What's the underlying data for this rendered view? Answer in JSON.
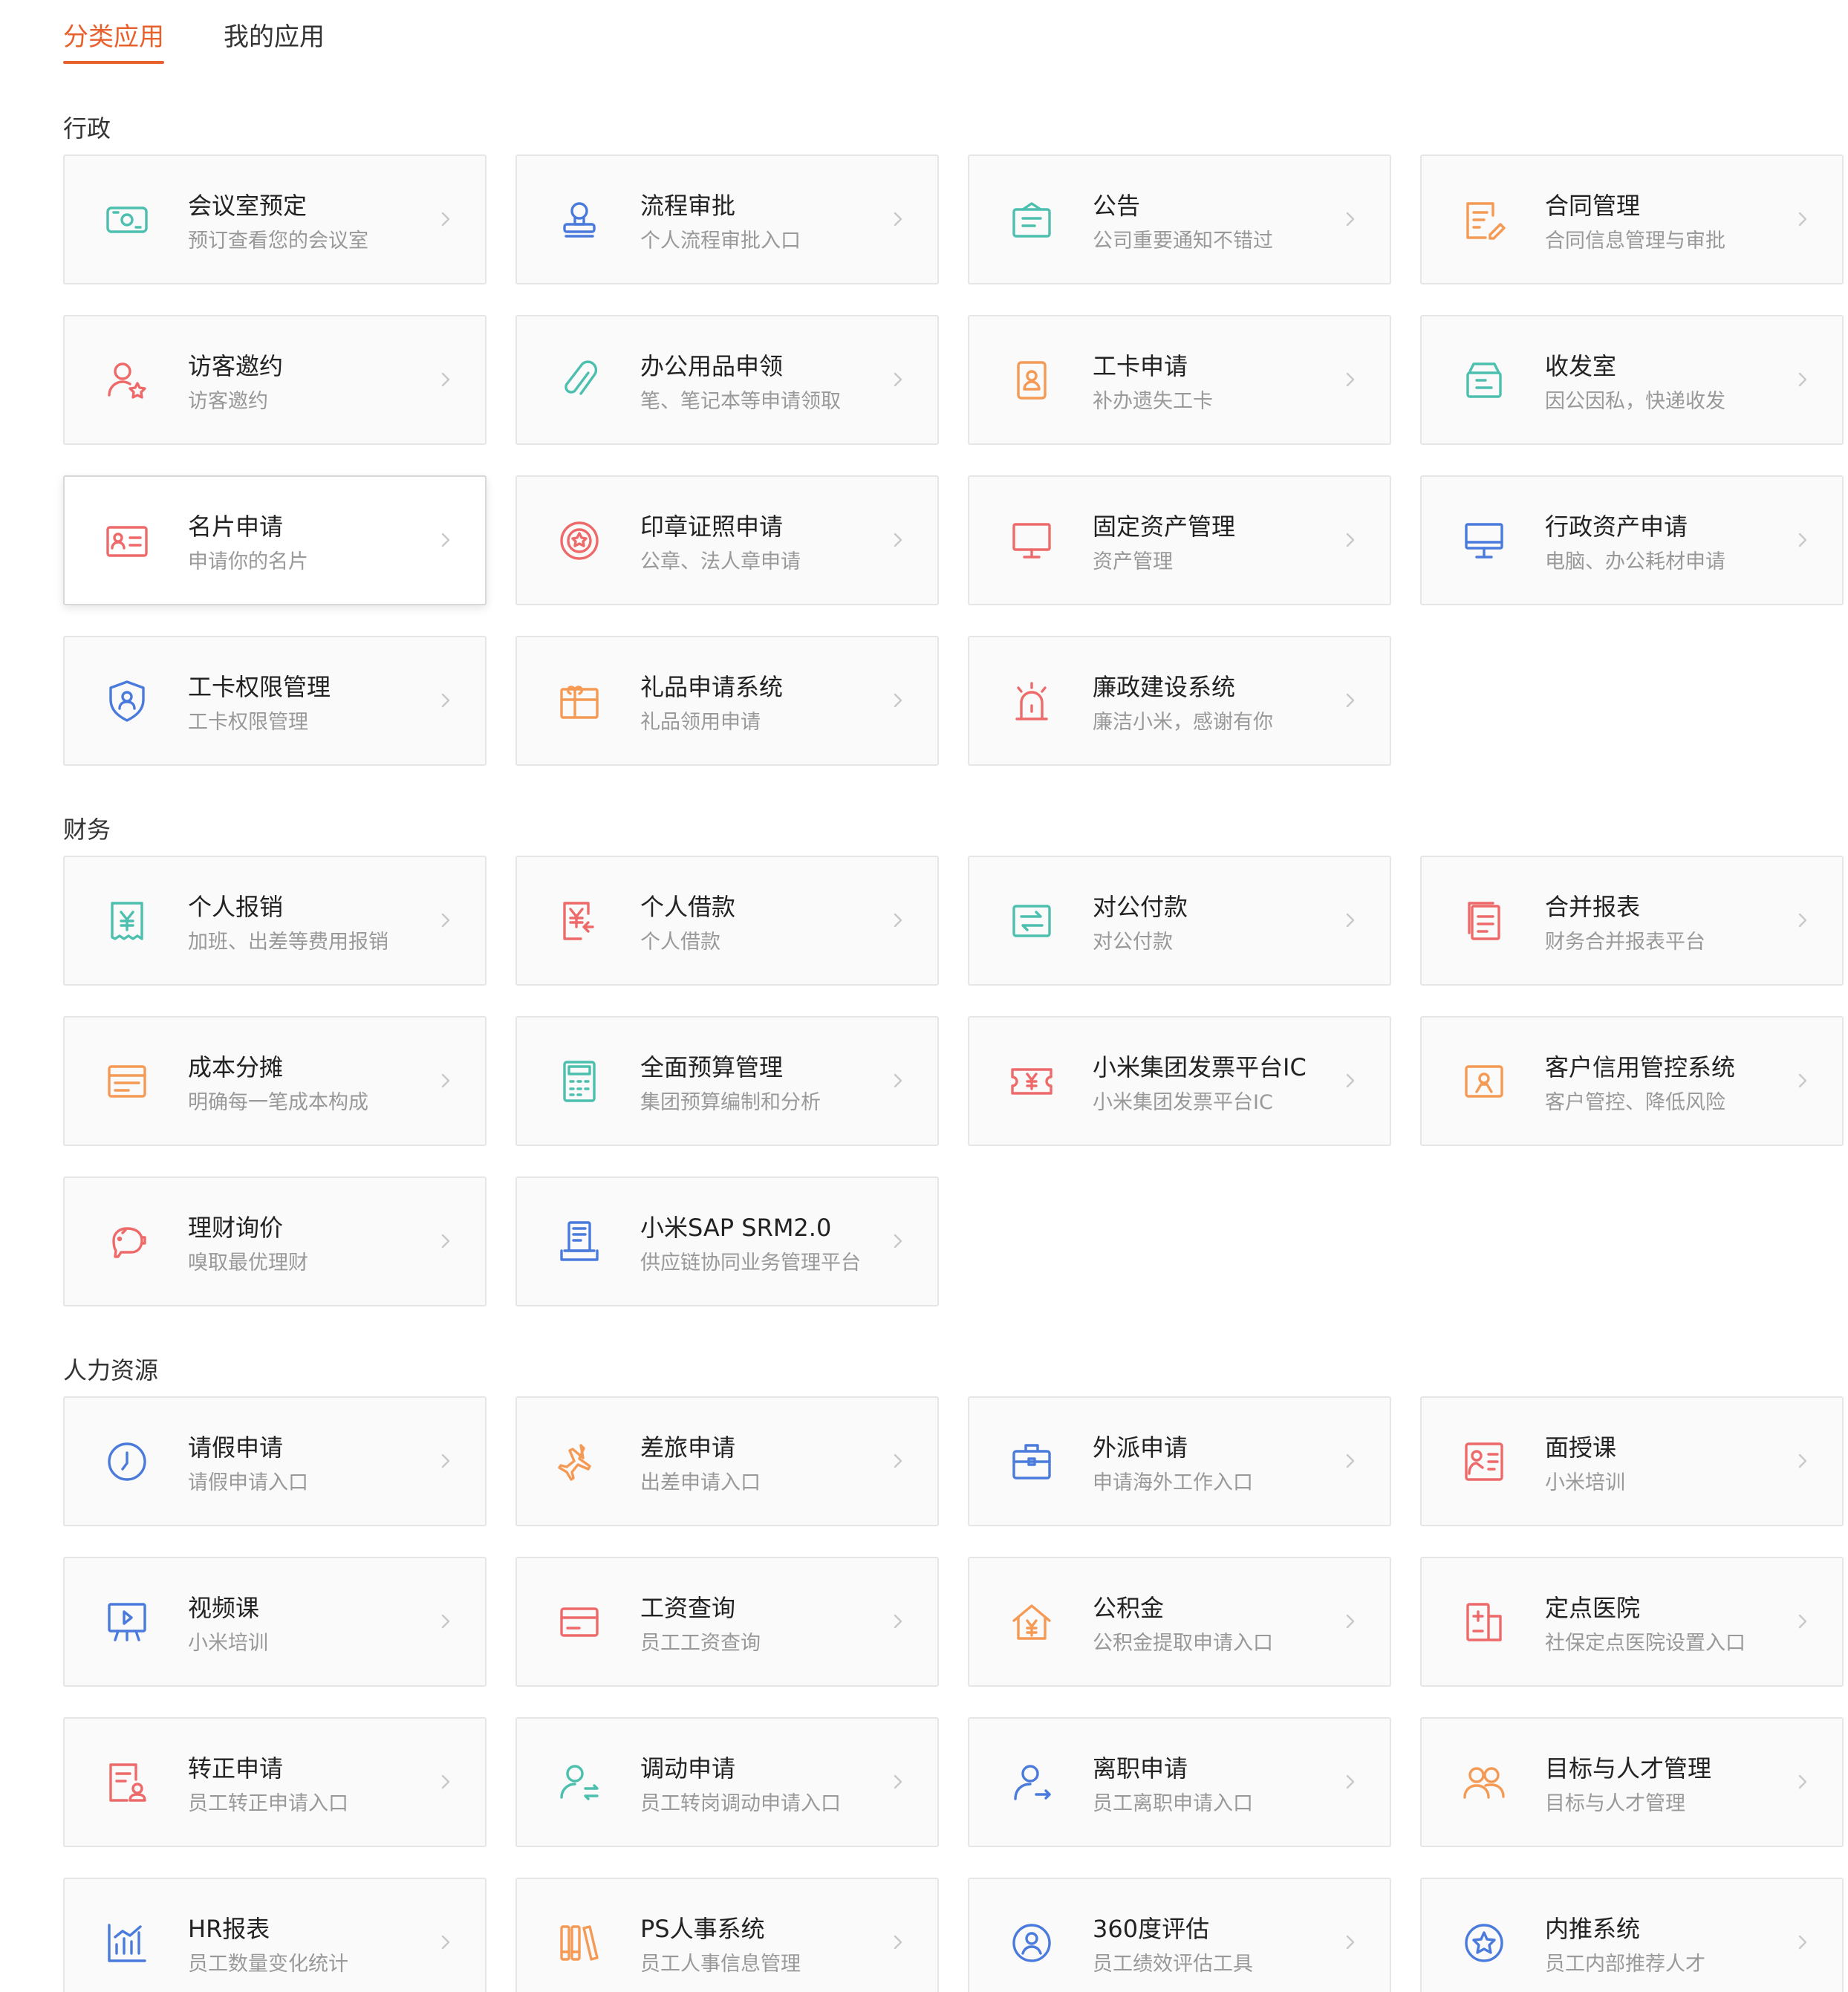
{
  "tabs": [
    {
      "label": "分类应用",
      "active": true
    },
    {
      "label": "我的应用",
      "active": false
    }
  ],
  "colors": {
    "accent": "#e8612c",
    "teal": "#4cbfae",
    "blue": "#4a7bdc",
    "orange": "#f59a54",
    "red": "#ee6a6a"
  },
  "sections": [
    {
      "title": "行政",
      "items": [
        {
          "title": "会议室预定",
          "subtitle": "预订查看您的会议室",
          "icon": "money-icon",
          "color": "#4cbfae"
        },
        {
          "title": "流程审批",
          "subtitle": "个人流程审批入口",
          "icon": "stamp-icon",
          "color": "#4a7bdc"
        },
        {
          "title": "公告",
          "subtitle": "公司重要通知不错过",
          "icon": "notice-icon",
          "color": "#4cbfae"
        },
        {
          "title": "合同管理",
          "subtitle": "合同信息管理与审批",
          "icon": "contract-edit-icon",
          "color": "#f59a54"
        },
        {
          "title": "访客邀约",
          "subtitle": "访客邀约",
          "icon": "visitor-star-icon",
          "color": "#ee6a6a"
        },
        {
          "title": "办公用品申领",
          "subtitle": "笔、笔记本等申请领取",
          "icon": "paperclip-icon",
          "color": "#4cbfae"
        },
        {
          "title": "工卡申请",
          "subtitle": "补办遗失工卡",
          "icon": "badge-icon",
          "color": "#f59a54"
        },
        {
          "title": "收发室",
          "subtitle": "因公因私，快递收发",
          "icon": "package-icon",
          "color": "#4cbfae"
        },
        {
          "title": "名片申请",
          "subtitle": "申请你的名片",
          "icon": "business-card-icon",
          "color": "#ee6a6a"
        },
        {
          "title": "印章证照申请",
          "subtitle": "公章、法人章申请",
          "icon": "seal-icon",
          "color": "#ee6a6a"
        },
        {
          "title": "固定资产管理",
          "subtitle": "资产管理",
          "icon": "monitor-icon",
          "color": "#ee6a6a"
        },
        {
          "title": "行政资产申请",
          "subtitle": "电脑、办公耗材申请",
          "icon": "computer-icon",
          "color": "#4a7bdc"
        },
        {
          "title": "工卡权限管理",
          "subtitle": "工卡权限管理",
          "icon": "shield-user-icon",
          "color": "#4a7bdc"
        },
        {
          "title": "礼品申请系统",
          "subtitle": "礼品领用申请",
          "icon": "gift-icon",
          "color": "#f59a54"
        },
        {
          "title": "廉政建设系统",
          "subtitle": "廉洁小米，感谢有你",
          "icon": "alarm-icon",
          "color": "#ee6a6a"
        }
      ]
    },
    {
      "title": "财务",
      "items": [
        {
          "title": "个人报销",
          "subtitle": "加班、出差等费用报销",
          "icon": "receipt-yen-icon",
          "color": "#4cbfae"
        },
        {
          "title": "个人借款",
          "subtitle": "个人借款",
          "icon": "loan-yen-icon",
          "color": "#ee6a6a"
        },
        {
          "title": "对公付款",
          "subtitle": "对公付款",
          "icon": "transfer-icon",
          "color": "#4cbfae"
        },
        {
          "title": "合并报表",
          "subtitle": "财务合并报表平台",
          "icon": "report-merge-icon",
          "color": "#ee6a6a"
        },
        {
          "title": "成本分摊",
          "subtitle": "明确每一笔成本构成",
          "icon": "cost-card-icon",
          "color": "#f59a54"
        },
        {
          "title": "全面预算管理",
          "subtitle": "集团预算编制和分析",
          "icon": "calculator-icon",
          "color": "#4cbfae"
        },
        {
          "title": "小米集团发票平台IC",
          "subtitle": "小米集团发票平台IC",
          "icon": "invoice-ticket-icon",
          "color": "#ee6a6a"
        },
        {
          "title": "客户信用管控系统",
          "subtitle": "客户管控、降低风险",
          "icon": "credit-icon",
          "color": "#f59a54"
        },
        {
          "title": "理财询价",
          "subtitle": "嗅取最优理财",
          "icon": "piggy-bank-icon",
          "color": "#ee6a6a"
        },
        {
          "title": "小米SAP SRM2.0",
          "subtitle": "供应链协同业务管理平台",
          "icon": "supply-doc-icon",
          "color": "#4a7bdc"
        }
      ]
    },
    {
      "title": "人力资源",
      "items": [
        {
          "title": "请假申请",
          "subtitle": "请假申请入口",
          "icon": "clock-icon",
          "color": "#4a7bdc"
        },
        {
          "title": "差旅申请",
          "subtitle": "出差申请入口",
          "icon": "airplane-icon",
          "color": "#f59a54"
        },
        {
          "title": "外派申请",
          "subtitle": "申请海外工作入口",
          "icon": "briefcase-icon",
          "color": "#4a7bdc"
        },
        {
          "title": "面授课",
          "subtitle": "小米培训",
          "icon": "lecture-icon",
          "color": "#ee6a6a"
        },
        {
          "title": "视频课",
          "subtitle": "小米培训",
          "icon": "video-board-icon",
          "color": "#4a7bdc"
        },
        {
          "title": "工资查询",
          "subtitle": "员工工资查询",
          "icon": "salary-card-icon",
          "color": "#ee6a6a"
        },
        {
          "title": "公积金",
          "subtitle": "公积金提取申请入口",
          "icon": "house-yen-icon",
          "color": "#f59a54"
        },
        {
          "title": "定点医院",
          "subtitle": "社保定点医院设置入口",
          "icon": "hospital-icon",
          "color": "#ee6a6a"
        },
        {
          "title": "转正申请",
          "subtitle": "员工转正申请入口",
          "icon": "doc-user-icon",
          "color": "#ee6a6a"
        },
        {
          "title": "调动申请",
          "subtitle": "员工转岗调动申请入口",
          "icon": "user-transfer-icon",
          "color": "#4cbfae"
        },
        {
          "title": "离职申请",
          "subtitle": "员工离职申请入口",
          "icon": "user-leave-icon",
          "color": "#4a7bdc"
        },
        {
          "title": "目标与人才管理",
          "subtitle": "目标与人才管理",
          "icon": "users-icon",
          "color": "#f59a54"
        },
        {
          "title": "HR报表",
          "subtitle": "员工数量变化统计",
          "icon": "bar-chart-icon",
          "color": "#4a7bdc"
        },
        {
          "title": "PS人事系统",
          "subtitle": "员工人事信息管理",
          "icon": "books-icon",
          "color": "#f59a54"
        },
        {
          "title": "360度评估",
          "subtitle": "员工绩效评估工具",
          "icon": "user-circle-icon",
          "color": "#4a7bdc"
        },
        {
          "title": "内推系统",
          "subtitle": "员工内部推荐人才",
          "icon": "star-circle-icon",
          "color": "#4a7bdc"
        }
      ]
    }
  ]
}
